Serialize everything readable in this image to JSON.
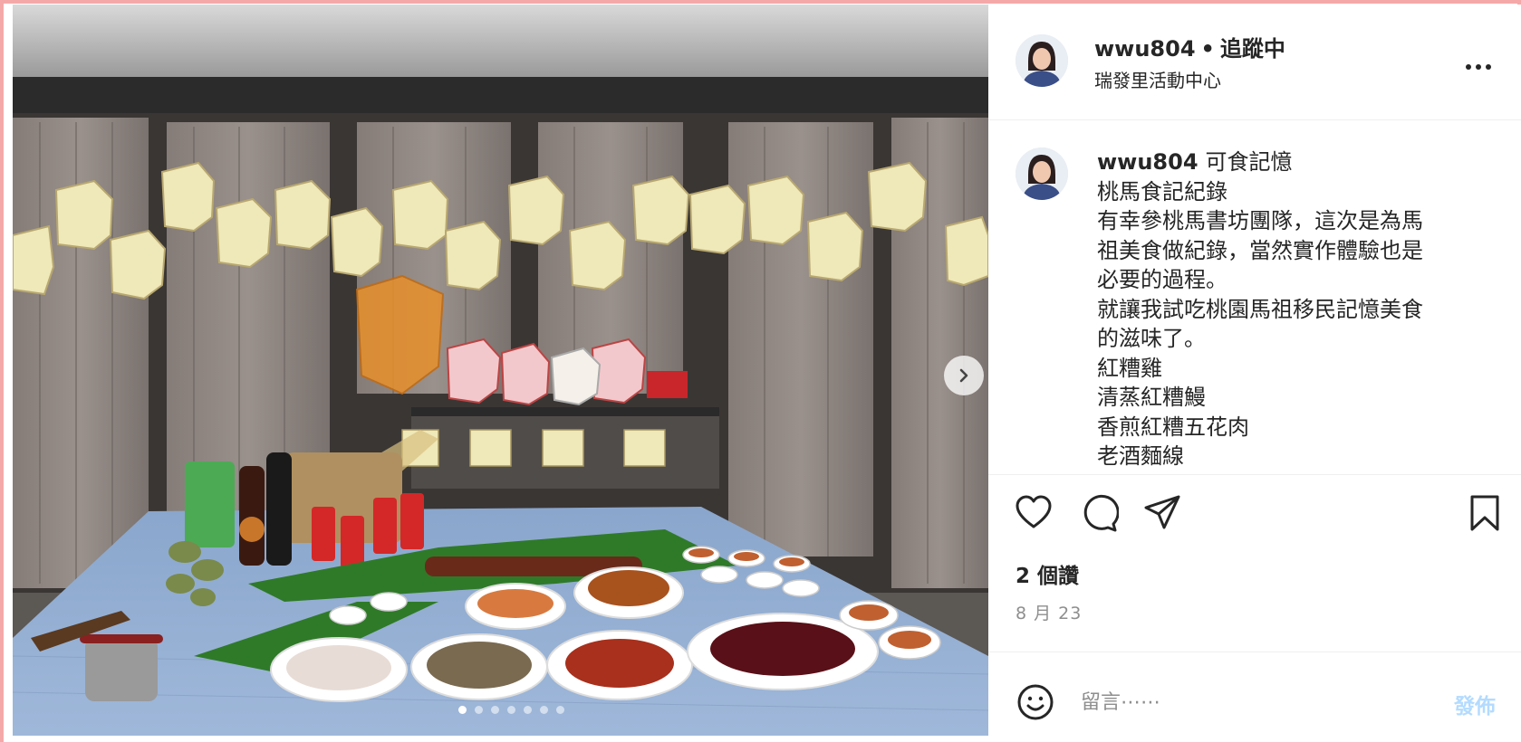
{
  "header": {
    "username": "wwu804",
    "separator": "•",
    "follow_status": "追蹤中",
    "location": "瑞發里活動中心",
    "more_icon": "more-horizontal-icon"
  },
  "caption": {
    "username": "wwu804",
    "lines": [
      "可食記憶",
      "桃馬食記紀錄",
      "有幸參桃馬書坊團隊，這次是為馬",
      "祖美食做紀錄，當然實作體驗也是",
      "必要的過程。",
      "就讓我試吃桃園馬祖移民記憶美食",
      "的滋味了。",
      "紅糟雞",
      "清蒸紅糟鰻",
      "香煎紅糟五花肉",
      "老酒麵線"
    ]
  },
  "actions": {
    "icons": [
      "heart-icon",
      "comment-icon",
      "share-icon",
      "bookmark-icon"
    ]
  },
  "likes": "2 個讚",
  "date": "8 月 23",
  "comment": {
    "placeholder": "留言⋯⋯",
    "post_label": "發佈"
  },
  "carousel": {
    "slide_count": 7,
    "active_index": 0
  },
  "colors": {
    "accent_blue": "#b3dbff",
    "text_primary": "#262626",
    "text_secondary": "#8e8e8e"
  }
}
